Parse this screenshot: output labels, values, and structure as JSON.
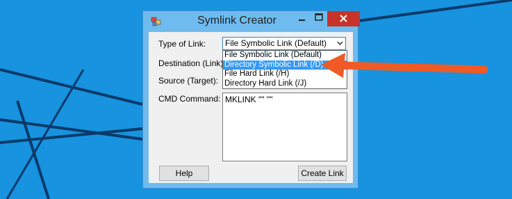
{
  "window": {
    "title": "Symlink Creator"
  },
  "form": {
    "type_label": "Type of Link:",
    "destination_label": "Destination (Link):",
    "source_label": "Source (Target):",
    "cmd_label": "CMD Command:",
    "type_selected": "File Symbolic Link (Default)",
    "type_options": [
      "File Symbolic Link (Default)",
      "Directory Symbolic Link (/D)",
      "File Hard Link (/H)",
      "Directory Hard Link (/J)"
    ],
    "highlighted_option": "Directory Symbolic Link (/D)",
    "cmd_value": "MKLINK \"\" \"\""
  },
  "buttons": {
    "help": "Help",
    "create": "Create Link"
  },
  "colors": {
    "desktop": "#1793df",
    "window_frame": "#6fbbef",
    "close_button": "#c7332b",
    "selection": "#3399ff",
    "annotation_arrow": "#f05a24"
  },
  "icons": {
    "app": "app-icon",
    "minimize": "minimize-icon",
    "maximize": "maximize-icon",
    "close": "close-icon",
    "dropdown": "chevron-down-icon"
  }
}
